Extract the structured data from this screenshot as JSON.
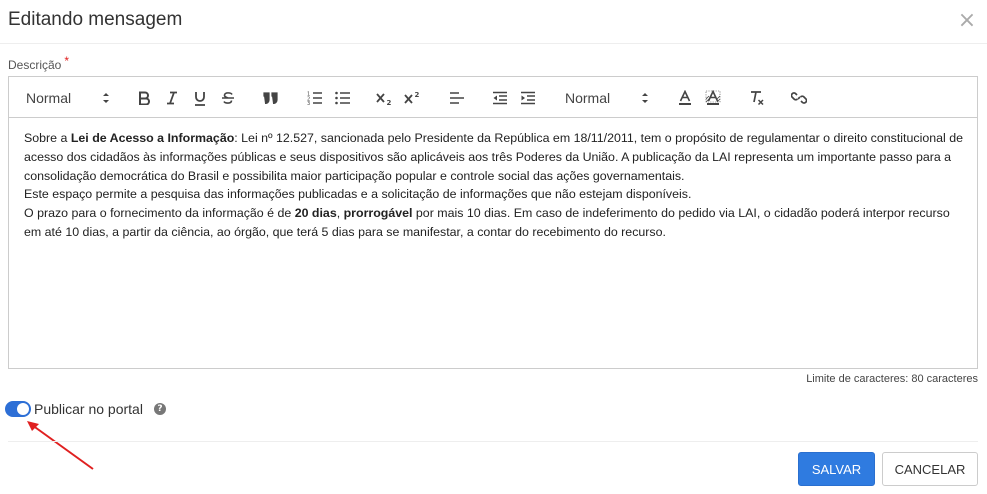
{
  "modal": {
    "title": "Editando mensagem",
    "close_icon": "close-icon",
    "close_glyph": "×"
  },
  "form": {
    "description_label": "Descrição",
    "required_mark": "*"
  },
  "toolbar": {
    "header_select": "Normal",
    "size_select": "Normal",
    "buttons": [
      "bold",
      "italic",
      "underline",
      "strike",
      "blockquote",
      "ordered-list",
      "bullet-list",
      "subscript",
      "superscript",
      "align",
      "outdent",
      "indent",
      "font-color",
      "background-color",
      "clean-format",
      "link"
    ]
  },
  "content": {
    "p1_prefix": "Sobre a ",
    "p1_bold": "Lei de Acesso a Informação",
    "p1_rest": ": Lei nº 12.527, sancionada pelo Presidente da República em 18/11/2011, tem o propósito de regulamentar o direito constitucional de acesso dos cidadãos às informações públicas e seus dispositivos são aplicáveis aos três Poderes da União. A publicação da LAI representa um importante passo para a consolidação democrática do Brasil e possibilita maior participação popular e controle social das ações governamentais.",
    "p2": "Este espaço permite a pesquisa das informações publicadas e a solicitação de informações que não estejam disponíveis.",
    "p3_prefix": "O prazo para o fornecimento da informação é de ",
    "p3_bold1": "20 dias",
    "p3_sep": ", ",
    "p3_bold2": "prorrogável",
    "p3_rest": " por mais 10 dias. Em caso de indeferimento do pedido via LAI, o cidadão poderá interpor recurso em até 10 dias, a partir da ciência, ao órgão, que terá 5 dias para se manifestar, a contar do recebimento do recurso."
  },
  "char_limit": "Limite de caracteres: 80 caracteres",
  "publish": {
    "label": "Publicar no portal",
    "enabled": true,
    "help_glyph": "?"
  },
  "buttons": {
    "save": "SALVAR",
    "cancel": "CANCELAR"
  },
  "colors": {
    "primary": "#2f7be0",
    "toggle_on": "#2d6fd6",
    "annotation_arrow": "#e02020"
  }
}
